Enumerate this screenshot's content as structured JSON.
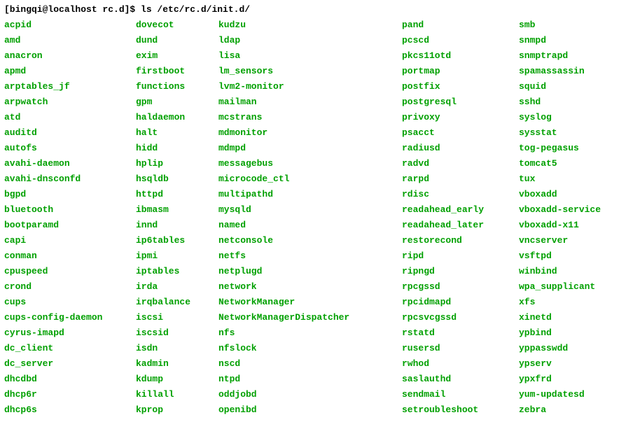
{
  "prompt": "[bingqi@localhost rc.d]$ ls /etc/rc.d/init.d/",
  "columns": [
    [
      "acpid",
      "amd",
      "anacron",
      "apmd",
      "arptables_jf",
      "arpwatch",
      "atd",
      "auditd",
      "autofs",
      "avahi-daemon",
      "avahi-dnsconfd",
      "bgpd",
      "bluetooth",
      "bootparamd",
      "capi",
      "conman",
      "cpuspeed",
      "crond",
      "cups",
      "cups-config-daemon",
      "cyrus-imapd",
      "dc_client",
      "dc_server",
      "dhcdbd",
      "dhcp6r",
      "dhcp6s"
    ],
    [
      "dovecot",
      "dund",
      "exim",
      "firstboot",
      "functions",
      "gpm",
      "haldaemon",
      "halt",
      "hidd",
      "hplip",
      "hsqldb",
      "httpd",
      "ibmasm",
      "innd",
      "ip6tables",
      "ipmi",
      "iptables",
      "irda",
      "irqbalance",
      "iscsi",
      "iscsid",
      "isdn",
      "kadmin",
      "kdump",
      "killall",
      "kprop"
    ],
    [
      "kudzu",
      "ldap",
      "lisa",
      "lm_sensors",
      "lvm2-monitor",
      "mailman",
      "mcstrans",
      "mdmonitor",
      "mdmpd",
      "messagebus",
      "microcode_ctl",
      "multipathd",
      "mysqld",
      "named",
      "netconsole",
      "netfs",
      "netplugd",
      "network",
      "NetworkManager",
      "NetworkManagerDispatcher",
      "nfs",
      "nfslock",
      "nscd",
      "ntpd",
      "oddjobd",
      "openibd"
    ],
    [
      "pand",
      "pcscd",
      "pkcs11otd",
      "portmap",
      "postfix",
      "postgresql",
      "privoxy",
      "psacct",
      "radiusd",
      "radvd",
      "rarpd",
      "rdisc",
      "readahead_early",
      "readahead_later",
      "restorecond",
      "ripd",
      "ripngd",
      "rpcgssd",
      "rpcidmapd",
      "rpcsvcgssd",
      "rstatd",
      "rusersd",
      "rwhod",
      "saslauthd",
      "sendmail",
      "setroubleshoot"
    ],
    [
      "smb",
      "snmpd",
      "snmptrapd",
      "spamassassin",
      "squid",
      "sshd",
      "syslog",
      "sysstat",
      "tog-pegasus",
      "tomcat5",
      "tux",
      "vboxadd",
      "vboxadd-service",
      "vboxadd-x11",
      "vncserver",
      "vsftpd",
      "winbind",
      "wpa_supplicant",
      "xfs",
      "xinetd",
      "ypbind",
      "yppasswdd",
      "ypserv",
      "ypxfrd",
      "yum-updatesd",
      "zebra"
    ]
  ]
}
